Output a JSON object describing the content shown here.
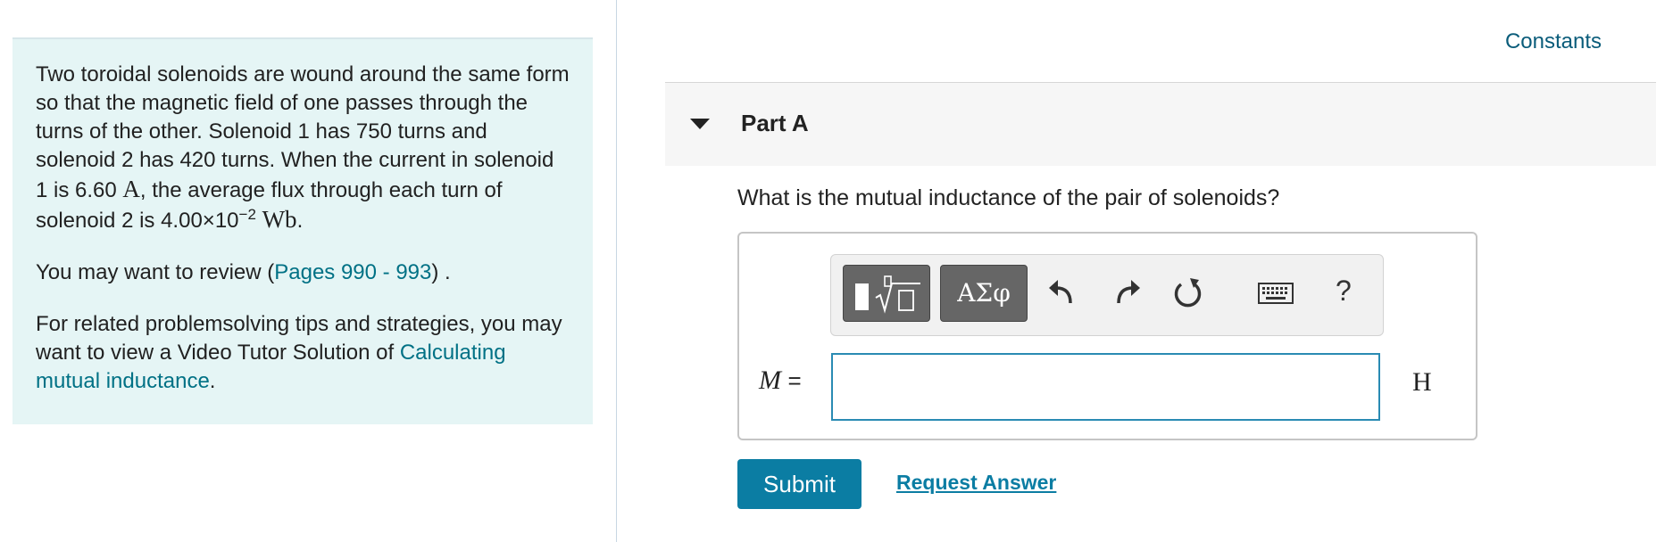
{
  "problem": {
    "text_part1": "Two toroidal solenoids are wound around the same form so that the magnetic field of one passes through the turns of the other. Solenoid 1 has 750 turns and solenoid 2 has 420 turns. When the current in solenoid 1 is 6.60 ",
    "current_unit": "A",
    "text_part2": ", the average flux through each turn of solenoid 2 is 4.00×10",
    "flux_exponent": "−2",
    "flux_unit": "Wb",
    "text_part3": ".",
    "review_prefix": "You may want to review (",
    "review_link": "Pages 990 - 993",
    "review_suffix": ") .",
    "tips_text": "For related problemsolving tips and strategies, you may want to view a Video Tutor Solution of ",
    "tips_link": "Calculating mutual inductance",
    "tips_suffix": "."
  },
  "header": {
    "constants_link": "Constants"
  },
  "part": {
    "title": "Part A",
    "question": "What is the mutual inductance of the pair of solenoids?"
  },
  "toolbar": {
    "greek_button": "ΑΣφ",
    "help_label": "?"
  },
  "answer": {
    "variable": "M",
    "equals": "=",
    "value": "",
    "unit": "H"
  },
  "actions": {
    "submit_label": "Submit",
    "request_label": "Request Answer"
  },
  "colors": {
    "panel_bg": "#e5f5f5",
    "link": "#007185",
    "submit_bg": "#0b7da3",
    "input_border": "#2a8bb3"
  }
}
